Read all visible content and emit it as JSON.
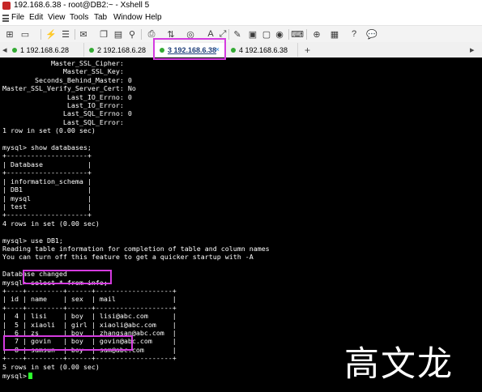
{
  "window": {
    "title": "192.168.6.38 - root@DB2:~ - Xshell 5"
  },
  "menu": [
    "File",
    "Edit",
    "View",
    "Tools",
    "Tab",
    "Window",
    "Help"
  ],
  "toolbar_icons": [
    "new-session-icon",
    "open-folder-icon",
    "disconnect-icon",
    "properties-icon",
    "compose-icon",
    "copy-icon",
    "paste-icon",
    "find-icon",
    "print-icon",
    "transfer-icon",
    "globe-icon",
    "font-icon",
    "fullscreen-icon",
    "script-icon",
    "lock-icon",
    "keyboard-icon",
    "new-tab-icon",
    "options-icon",
    "help-icon"
  ],
  "tabs": [
    {
      "label": "1 192.168.6.28",
      "active": false
    },
    {
      "label": "2 192.168.6.28",
      "active": false
    },
    {
      "label": "3 192.168.6.38",
      "active": true
    },
    {
      "label": "4 192.168.6.38",
      "active": false
    }
  ],
  "tab_close_glyph": "×",
  "tab_add_glyph": "+",
  "tab_nav": {
    "prev": "◂",
    "next": "▸"
  },
  "terminal": {
    "lines": [
      "            Master_SSL_Cipher:",
      "               Master_SSL_Key:",
      "        Seconds_Behind_Master: 0",
      "Master_SSL_Verify_Server_Cert: No",
      "                Last_IO_Errno: 0",
      "                Last_IO_Error:",
      "               Last_SQL_Errno: 0",
      "               Last_SQL_Error:",
      "1 row in set (0.00 sec)",
      "",
      "mysql> show databases;",
      "+--------------------+",
      "| Database           |",
      "+--------------------+",
      "| information_schema |",
      "| DB1                |",
      "| mysql              |",
      "| test               |",
      "+--------------------+",
      "4 rows in set (0.00 sec)",
      "",
      "mysql> use DB1;",
      "Reading table information for completion of table and column names",
      "You can turn off this feature to get a quicker startup with -A",
      "",
      "Database changed",
      "mysql> select * from info;",
      "+----+---------+------+-------------------+",
      "| id | name    | sex  | mail              |",
      "+----+---------+------+-------------------+",
      "|  4 | lisi    | boy  | lisi@abc.com      |",
      "|  5 | xiaoli  | girl | xiaoli@abc.com    |",
      "|  6 | zs      | boy  | zhangsan@abc.com  |",
      "|  7 | govin   | boy  | govin@abc.com     |",
      "|  8 | samsun  | boy  | sam@abc.com       |",
      "+----+---------+------+-------------------+",
      "5 rows in set (0.00 sec)"
    ],
    "prompt": "mysql> ",
    "cursor_color": "#2cff2c"
  },
  "watermark": "高文龙",
  "colors": {
    "highlight": "#d53be0",
    "terminal_bg": "#000000",
    "terminal_fg": "#ffffff",
    "connected_dot": "#33aa33",
    "tab_close": "#1d7bd8"
  }
}
